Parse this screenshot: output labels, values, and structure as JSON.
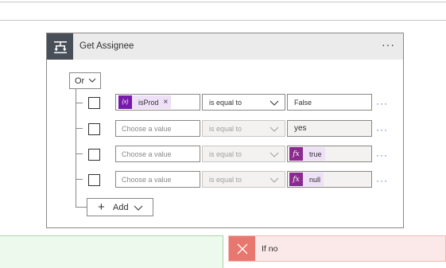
{
  "card": {
    "title": "Get Assignee",
    "more": "···",
    "icon": "condition-icon"
  },
  "group": {
    "operator": "Or"
  },
  "rows": [
    {
      "operand_token": "isProd",
      "operand_token_type": "variable",
      "operator": "is equal to",
      "value": "False",
      "more": "···"
    },
    {
      "operand_placeholder": "Choose a value",
      "operator": "is equal to",
      "value": "yes",
      "more": "···"
    },
    {
      "operand_placeholder": "Choose a value",
      "operator": "is equal to",
      "value_token": "true",
      "value_token_type": "expression",
      "more": "···"
    },
    {
      "operand_placeholder": "Choose a value",
      "operator": "is equal to",
      "value_token": "null",
      "value_token_type": "expression",
      "more": "···"
    }
  ],
  "add_button": {
    "label": "Add"
  },
  "branches": {
    "no_label": "If no"
  },
  "colors": {
    "variable_token": "#7719aa",
    "expression_token": "#8c2b8f",
    "no_branch_accent": "#e8786f",
    "yes_branch_bg": "#eef9ee",
    "header_icon_bg": "#484f58"
  }
}
